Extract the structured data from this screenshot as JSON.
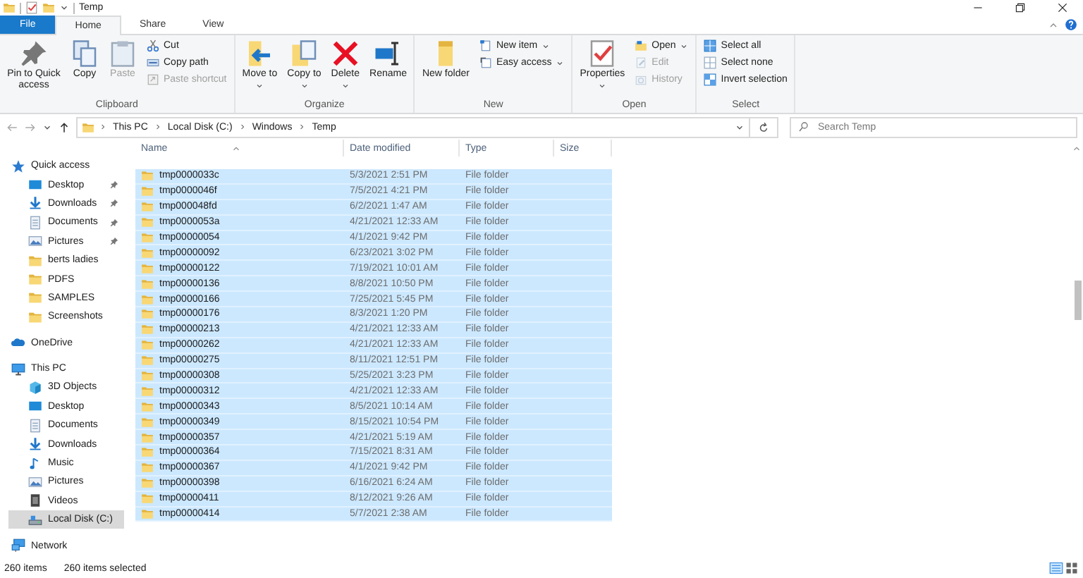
{
  "window": {
    "title": "Temp"
  },
  "ribbon_tabs": [
    {
      "label": "File",
      "kind": "file",
      "selected": false
    },
    {
      "label": "Home",
      "kind": "tab",
      "selected": true
    },
    {
      "label": "Share",
      "kind": "tab",
      "selected": false
    },
    {
      "label": "View",
      "kind": "tab",
      "selected": false
    }
  ],
  "ribbon_groups": [
    {
      "label": "Clipboard",
      "items": [
        {
          "kind": "large",
          "label": "Pin to Quick access",
          "disabled": false,
          "dropdown": false
        },
        {
          "kind": "large",
          "label": "Copy",
          "disabled": false,
          "dropdown": false
        },
        {
          "kind": "large",
          "label": "Paste",
          "disabled": true,
          "dropdown": false
        },
        {
          "kind": "small",
          "label": "Cut",
          "disabled": false,
          "dropdown": false
        },
        {
          "kind": "small",
          "label": "Copy path",
          "disabled": false,
          "dropdown": false
        },
        {
          "kind": "small",
          "label": "Paste shortcut",
          "disabled": true,
          "dropdown": false
        }
      ]
    },
    {
      "label": "Organize",
      "items": [
        {
          "kind": "large",
          "label": "Move to",
          "disabled": false,
          "dropdown": true
        },
        {
          "kind": "large",
          "label": "Copy to",
          "disabled": false,
          "dropdown": true
        },
        {
          "kind": "large",
          "label": "Delete",
          "disabled": false,
          "dropdown": true
        },
        {
          "kind": "large",
          "label": "Rename",
          "disabled": false,
          "dropdown": false
        }
      ]
    },
    {
      "label": "New",
      "items": [
        {
          "kind": "large",
          "label": "New folder",
          "disabled": false,
          "dropdown": false
        },
        {
          "kind": "small",
          "label": "New item",
          "disabled": false,
          "dropdown": true
        },
        {
          "kind": "small",
          "label": "Easy access",
          "disabled": false,
          "dropdown": true
        }
      ]
    },
    {
      "label": "Open",
      "items": [
        {
          "kind": "large",
          "label": "Properties",
          "disabled": false,
          "dropdown": true
        },
        {
          "kind": "small",
          "label": "Open",
          "disabled": false,
          "dropdown": true
        },
        {
          "kind": "small",
          "label": "Edit",
          "disabled": true,
          "dropdown": false
        },
        {
          "kind": "small",
          "label": "History",
          "disabled": true,
          "dropdown": false
        }
      ]
    },
    {
      "label": "Select",
      "items": [
        {
          "kind": "small",
          "label": "Select all",
          "disabled": false,
          "dropdown": false
        },
        {
          "kind": "small",
          "label": "Select none",
          "disabled": false,
          "dropdown": false
        },
        {
          "kind": "small",
          "label": "Invert selection",
          "disabled": false,
          "dropdown": false
        }
      ]
    }
  ],
  "address": {
    "path": [
      "This PC",
      "Local Disk (C:)",
      "Windows",
      "Temp"
    ],
    "search_placeholder": "Search Temp"
  },
  "nav": {
    "items": [
      {
        "label": "Quick access",
        "kind": "quick_access",
        "selected": false,
        "children": [
          {
            "label": "Desktop",
            "kind": "desktop",
            "selected": false,
            "pinned": true
          },
          {
            "label": "Downloads",
            "kind": "downloads",
            "selected": false,
            "pinned": true
          },
          {
            "label": "Documents",
            "kind": "documents",
            "selected": false,
            "pinned": true
          },
          {
            "label": "Pictures",
            "kind": "pictures",
            "selected": false,
            "pinned": true
          },
          {
            "label": "berts ladies",
            "kind": "folder",
            "selected": false,
            "pinned": false
          },
          {
            "label": "PDFS",
            "kind": "folder",
            "selected": false,
            "pinned": false
          },
          {
            "label": "SAMPLES",
            "kind": "folder",
            "selected": false,
            "pinned": false
          },
          {
            "label": "Screenshots",
            "kind": "folder",
            "selected": false,
            "pinned": false
          }
        ]
      },
      {
        "label": "OneDrive",
        "kind": "onedrive",
        "selected": false
      },
      {
        "label": "This PC",
        "kind": "this_pc",
        "selected": false,
        "children": [
          {
            "label": "3D Objects",
            "kind": "objects_3d",
            "selected": false
          },
          {
            "label": "Desktop",
            "kind": "desktop",
            "selected": false
          },
          {
            "label": "Documents",
            "kind": "documents",
            "selected": false
          },
          {
            "label": "Downloads",
            "kind": "downloads",
            "selected": false
          },
          {
            "label": "Music",
            "kind": "music",
            "selected": false
          },
          {
            "label": "Pictures",
            "kind": "pictures",
            "selected": false
          },
          {
            "label": "Videos",
            "kind": "videos",
            "selected": false
          },
          {
            "label": "Local Disk (C:)",
            "kind": "drive",
            "selected": true
          }
        ]
      },
      {
        "label": "Network",
        "kind": "network",
        "selected": false
      }
    ]
  },
  "files": {
    "columns": [
      "Name",
      "Date modified",
      "Type",
      "Size"
    ],
    "rows": [
      {
        "name": "tmp0000033c",
        "date": "5/3/2021 2:51 PM",
        "type": "File folder",
        "selected": true
      },
      {
        "name": "tmp0000046f",
        "date": "7/5/2021 4:21 PM",
        "type": "File folder",
        "selected": true
      },
      {
        "name": "tmp000048fd",
        "date": "6/2/2021 1:47 AM",
        "type": "File folder",
        "selected": true
      },
      {
        "name": "tmp0000053a",
        "date": "4/21/2021 12:33 AM",
        "type": "File folder",
        "selected": true
      },
      {
        "name": "tmp00000054",
        "date": "4/1/2021 9:42 PM",
        "type": "File folder",
        "selected": true
      },
      {
        "name": "tmp00000092",
        "date": "6/23/2021 3:02 PM",
        "type": "File folder",
        "selected": true
      },
      {
        "name": "tmp00000122",
        "date": "7/19/2021 10:01 AM",
        "type": "File folder",
        "selected": true
      },
      {
        "name": "tmp00000136",
        "date": "8/8/2021 10:50 PM",
        "type": "File folder",
        "selected": true
      },
      {
        "name": "tmp00000166",
        "date": "7/25/2021 5:45 PM",
        "type": "File folder",
        "selected": true
      },
      {
        "name": "tmp00000176",
        "date": "8/3/2021 1:20 PM",
        "type": "File folder",
        "selected": true
      },
      {
        "name": "tmp00000213",
        "date": "4/21/2021 12:33 AM",
        "type": "File folder",
        "selected": true
      },
      {
        "name": "tmp00000262",
        "date": "4/21/2021 12:33 AM",
        "type": "File folder",
        "selected": true
      },
      {
        "name": "tmp00000275",
        "date": "8/11/2021 12:51 PM",
        "type": "File folder",
        "selected": true
      },
      {
        "name": "tmp00000308",
        "date": "5/25/2021 3:23 PM",
        "type": "File folder",
        "selected": true
      },
      {
        "name": "tmp00000312",
        "date": "4/21/2021 12:33 AM",
        "type": "File folder",
        "selected": true
      },
      {
        "name": "tmp00000343",
        "date": "8/5/2021 10:14 AM",
        "type": "File folder",
        "selected": true
      },
      {
        "name": "tmp00000349",
        "date": "8/15/2021 10:54 PM",
        "type": "File folder",
        "selected": true
      },
      {
        "name": "tmp00000357",
        "date": "4/21/2021 5:19 AM",
        "type": "File folder",
        "selected": true
      },
      {
        "name": "tmp00000364",
        "date": "7/15/2021 8:31 AM",
        "type": "File folder",
        "selected": true
      },
      {
        "name": "tmp00000367",
        "date": "4/1/2021 9:42 PM",
        "type": "File folder",
        "selected": true
      },
      {
        "name": "tmp00000398",
        "date": "6/16/2021 6:24 AM",
        "type": "File folder",
        "selected": true
      },
      {
        "name": "tmp00000411",
        "date": "8/12/2021 9:26 AM",
        "type": "File folder",
        "selected": true
      },
      {
        "name": "tmp00000414",
        "date": "5/7/2021 2:38 AM",
        "type": "File folder",
        "selected": true
      }
    ]
  },
  "status_bar": {
    "item_count": "260 items",
    "selection": "260 items selected"
  }
}
